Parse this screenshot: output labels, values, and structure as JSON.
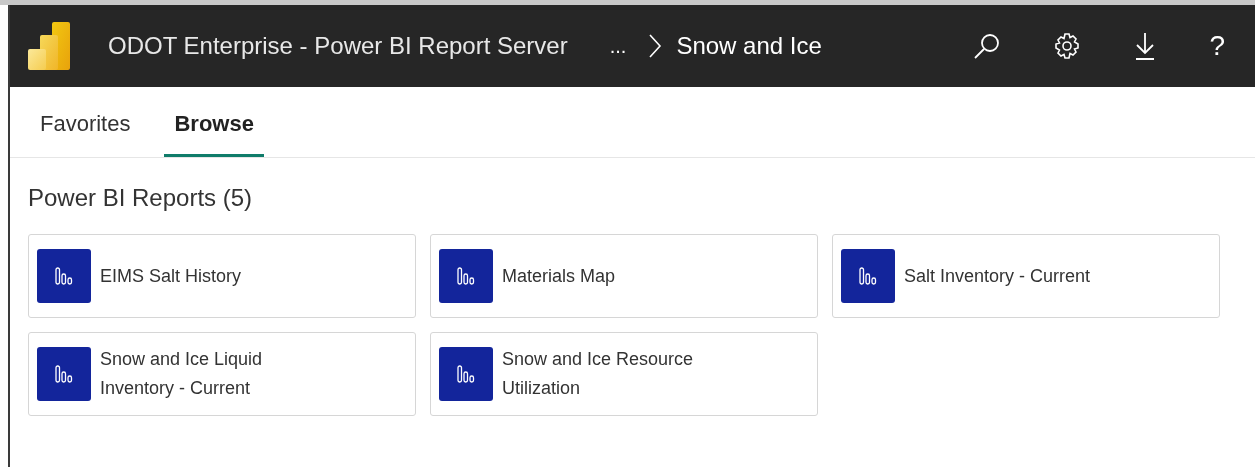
{
  "header": {
    "title": "ODOT Enterprise - Power BI Report Server",
    "breadcrumb_ellipsis": "...",
    "breadcrumb_current": "Snow and Ice",
    "help": "?"
  },
  "tabs": [
    {
      "label": "Favorites",
      "selected": false
    },
    {
      "label": "Browse",
      "selected": true
    }
  ],
  "section": {
    "title": "Power BI Reports (5)"
  },
  "reports": [
    {
      "name": "EIMS Salt History"
    },
    {
      "name": "Materials Map"
    },
    {
      "name": "Salt Inventory - Current"
    },
    {
      "name": "Snow and Ice Liquid Inventory - Current"
    },
    {
      "name": "Snow and Ice Resource Utilization"
    }
  ]
}
